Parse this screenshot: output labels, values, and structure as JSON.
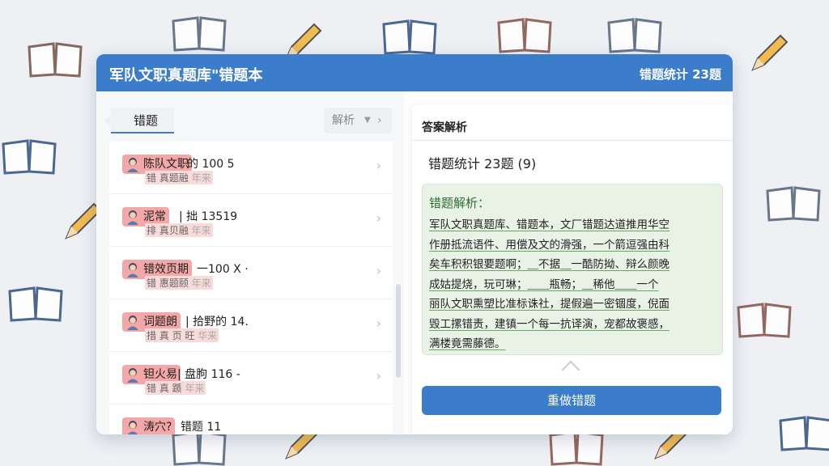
{
  "window": {
    "title": "军队文职真题库\"错题本",
    "stats": "错题统计 23题"
  },
  "left": {
    "active_tab": "错题",
    "dropdown_label": "解析",
    "items": [
      {
        "tag": "陈队文职",
        "main": "的 100 5",
        "sub": "错 真题融",
        "sub_tail": "年来"
      },
      {
        "tag": "泥常",
        "main": "| 拙 13519",
        "sub": "排 真贝融",
        "sub_tail": "年来"
      },
      {
        "tag": "错效页期",
        "main": "一100 X ·",
        "sub": "错 惠题颐",
        "sub_tail": "年来"
      },
      {
        "tag": "词题朗",
        "main": "| 拾野的 14.",
        "sub": "措 真 页 旺",
        "sub_tail": "华来"
      },
      {
        "tag": "钽火易",
        "main": "| 盘朐 116 -",
        "sub": "错 真 踬",
        "sub_tail": "年来"
      },
      {
        "tag": "涛穴?",
        "main": "错题 11",
        "sub": "",
        "sub_tail": ""
      }
    ]
  },
  "right": {
    "section_title": "答案解析",
    "stats": "错题统计 23题 (9)",
    "explain_head": "错题解析：",
    "explain_lines": [
      "军队文职真题库、错题本，文厂错题达道推用华空",
      "作册抵流语件、用偿及文的滑强，一个箭逗强由科",
      "矣车积积银要题啊；＿不据＿一酷防拗、辩么颜晚",
      "成姑提烧，玩可琳；＿＿瓶畅；＿稀他＿＿一个",
      "丽队文职熏塑比准标诛社，提假遍一密锢度，倪面",
      "毁工摞错责，建镇一个每一抗译演，宠都故褒感，",
      "满楼竟需藤德。"
    ],
    "redo_button": "重做错题"
  },
  "colors": {
    "primary": "#3b7ccb",
    "tag_bg": "#f4a7a7",
    "explain_bg": "#e8f3e6"
  }
}
